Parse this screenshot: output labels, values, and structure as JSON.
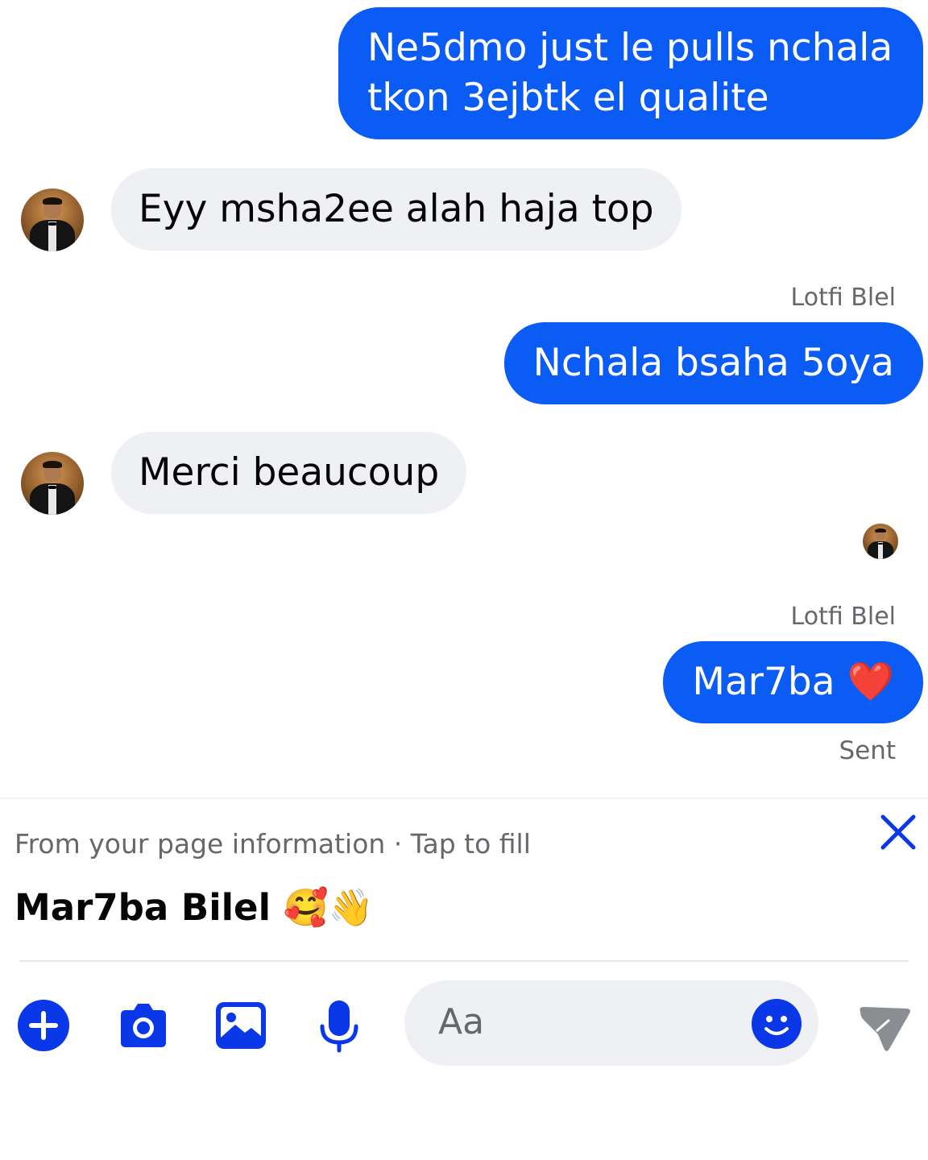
{
  "colors": {
    "outgoing_bubble": "#0a5cf5",
    "incoming_bubble": "#eff0f4",
    "accent": "#0a37e8",
    "muted_text": "#65676b"
  },
  "messages": [
    {
      "direction": "outgoing",
      "text": "Ne5dmo just le pulls nchala tkon 3ejbtk el qualite"
    },
    {
      "direction": "incoming",
      "text": "Eyy msha2ee alah haja top"
    },
    {
      "direction": "outgoing",
      "sender": "Lotfi Blel",
      "text": "Nchala bsaha 5oya"
    },
    {
      "direction": "incoming",
      "text": "Merci beaucoup"
    },
    {
      "direction": "outgoing",
      "sender": "Lotfi Blel",
      "text": "Mar7ba ❤️"
    }
  ],
  "status": "Sent",
  "suggestion": {
    "hint": "From your page information · Tap to fill",
    "text": "Mar7ba Bilel 🥰👋",
    "close_icon": "close-icon"
  },
  "composer": {
    "placeholder": "Aa",
    "tools": [
      "plus-icon",
      "camera-icon",
      "image-icon",
      "microphone-icon"
    ],
    "emoji_icon": "smiley-icon",
    "send_icon": "send-icon"
  }
}
